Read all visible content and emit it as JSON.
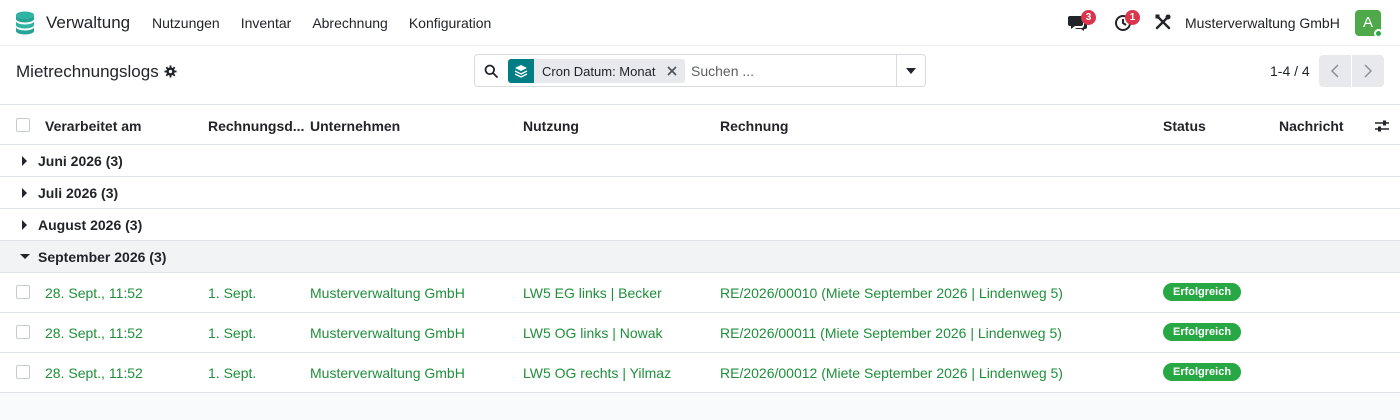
{
  "app": {
    "name": "Verwaltung",
    "logo_icon": "database-stack-icon"
  },
  "menu": [
    "Nutzungen",
    "Inventar",
    "Abrechnung",
    "Konfiguration"
  ],
  "systray": {
    "messages_badge": "3",
    "activities_badge": "1",
    "company": "Musterverwaltung GmbH",
    "avatar_letter": "A"
  },
  "control_panel": {
    "title": "Mietrechnungslogs",
    "facet_label": "Cron Datum: Monat",
    "search_placeholder": "Suchen ...",
    "pager": "1-4 / 4"
  },
  "columns": [
    "Verarbeitet am",
    "Rechnungsd...",
    "Unternehmen",
    "Nutzung",
    "Rechnung",
    "Status",
    "Nachricht"
  ],
  "groups": [
    {
      "label": "Juni 2026",
      "count": "(3)",
      "open": false
    },
    {
      "label": "Juli 2026",
      "count": "(3)",
      "open": false
    },
    {
      "label": "August 2026",
      "count": "(3)",
      "open": false
    },
    {
      "label": "September 2026",
      "count": "(3)",
      "open": true
    }
  ],
  "rows": [
    {
      "processed": "28. Sept., 11:52",
      "invoice_date": "1. Sept.",
      "company": "Musterverwaltung GmbH",
      "usage": "LW5 EG links | Becker",
      "invoice": "RE/2026/00010 (Miete September 2026 | Lindenweg 5)",
      "status": "Erfolgreich"
    },
    {
      "processed": "28. Sept., 11:52",
      "invoice_date": "1. Sept.",
      "company": "Musterverwaltung GmbH",
      "usage": "LW5 OG links | Nowak",
      "invoice": "RE/2026/00011 (Miete September 2026 | Lindenweg 5)",
      "status": "Erfolgreich"
    },
    {
      "processed": "28. Sept., 11:52",
      "invoice_date": "1. Sept.",
      "company": "Musterverwaltung GmbH",
      "usage": "LW5 OG rechts | Yilmaz",
      "invoice": "RE/2026/00012 (Miete September 2026 | Lindenweg 5)",
      "status": "Erfolgreich"
    }
  ],
  "colors": {
    "accent_green": "#1f8f3a",
    "badge_green": "#28a745",
    "facet_teal": "#017e84",
    "badge_red": "#d9364d"
  }
}
